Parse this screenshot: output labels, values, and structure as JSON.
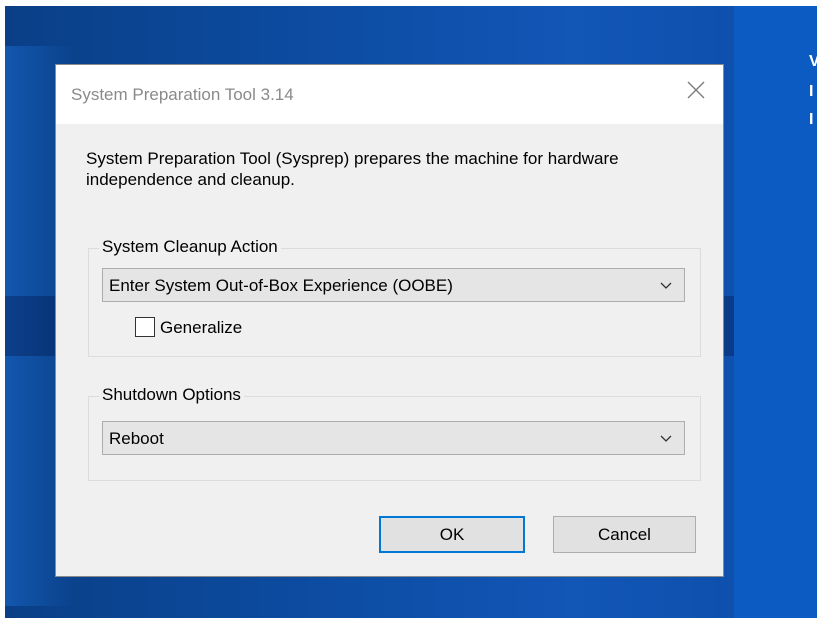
{
  "window": {
    "title": "System Preparation Tool 3.14"
  },
  "description": "System Preparation Tool (Sysprep) prepares the machine for hardware independence and cleanup.",
  "cleanup": {
    "group_label": "System Cleanup Action",
    "selected": "Enter System Out-of-Box Experience (OOBE)",
    "generalize_label": "Generalize",
    "generalize_checked": false
  },
  "shutdown": {
    "group_label": "Shutdown Options",
    "selected": "Reboot"
  },
  "buttons": {
    "ok": "OK",
    "cancel": "Cancel"
  },
  "desktop": {
    "partial_text": [
      "V",
      "I",
      "I"
    ]
  },
  "colors": {
    "desktop": "#0d4ea6",
    "accent": "#0078d7",
    "dialog_bg": "#f0f0f0"
  },
  "icons": {
    "close": "close-icon",
    "dropdown": "chevron-down-icon"
  }
}
